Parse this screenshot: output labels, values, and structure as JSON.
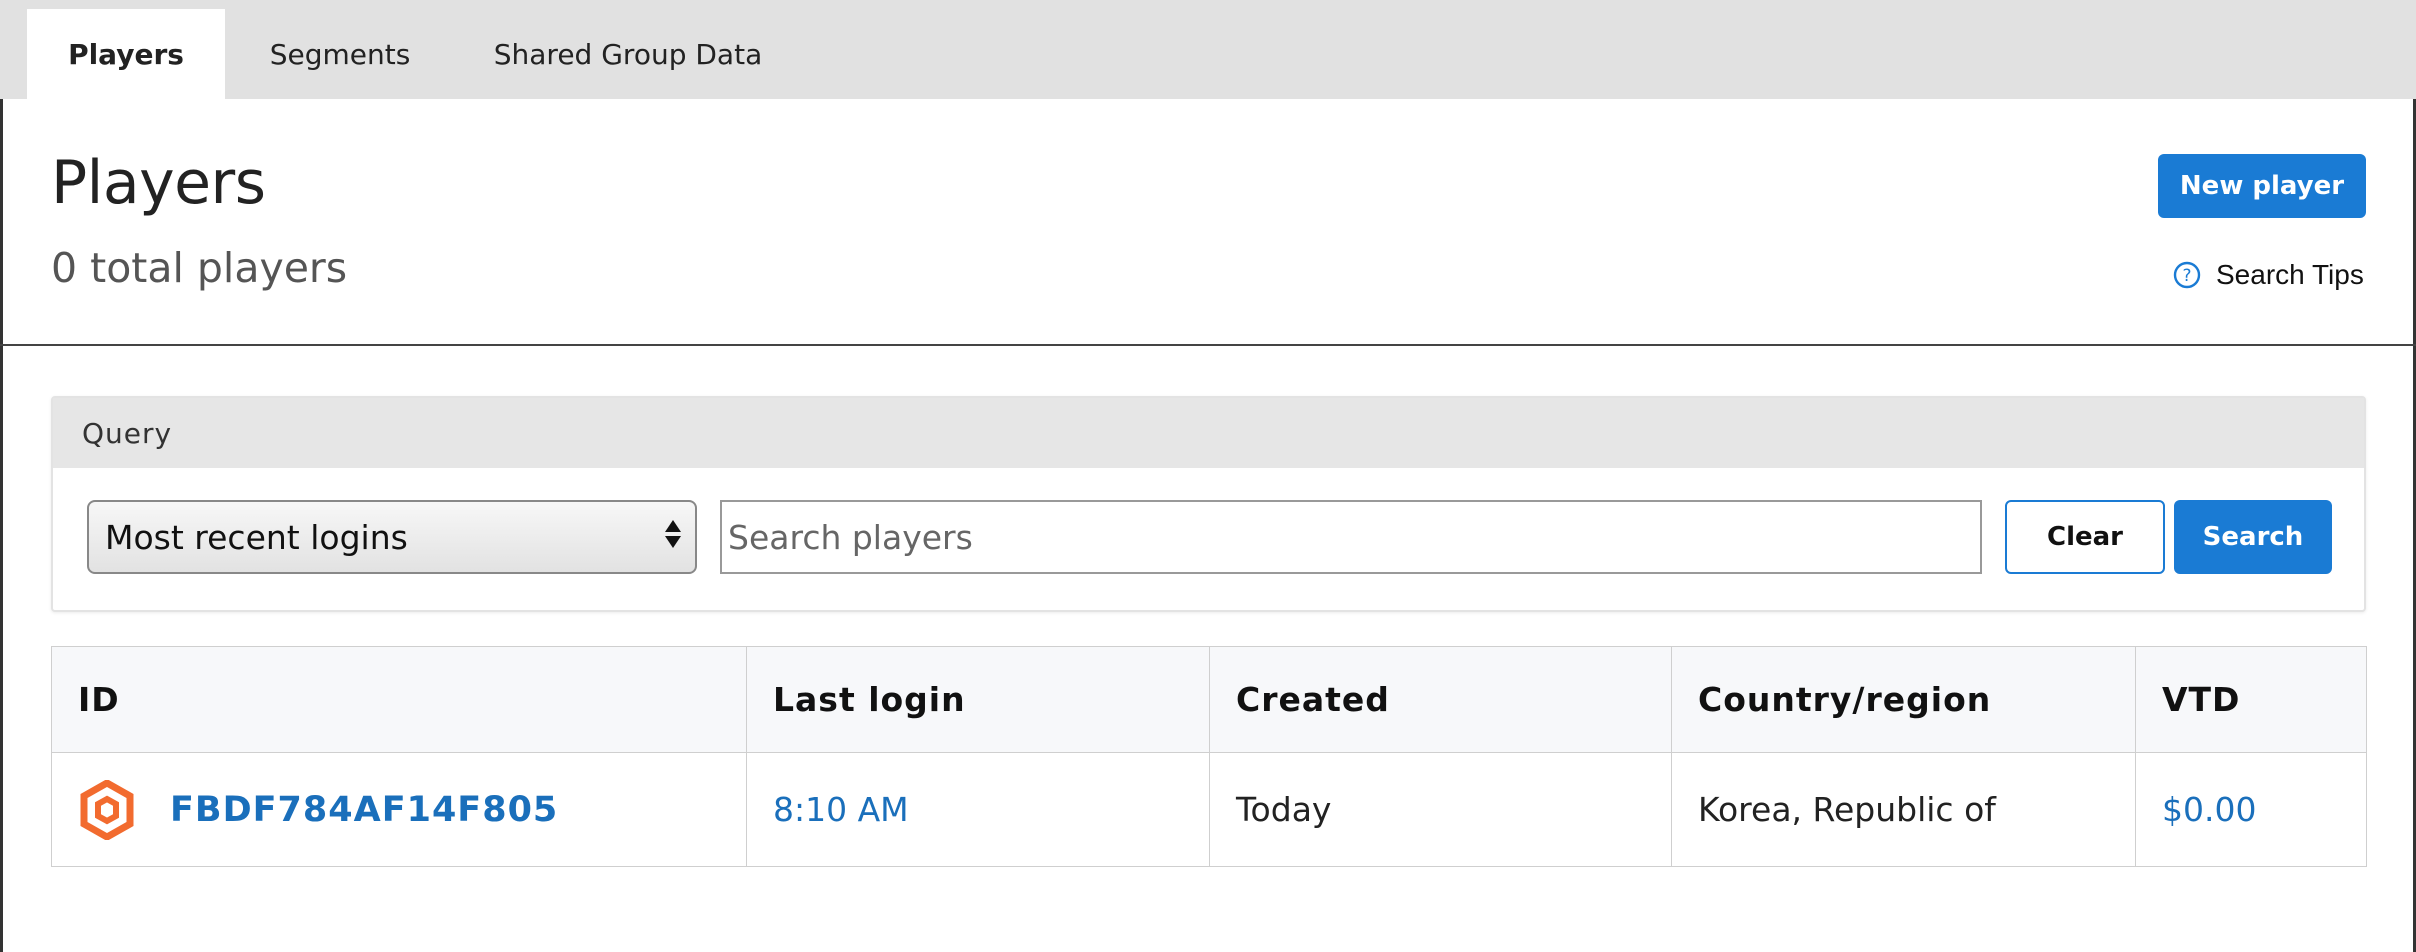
{
  "tabs": [
    {
      "label": "Players",
      "active": true
    },
    {
      "label": "Segments",
      "active": false
    },
    {
      "label": "Shared Group Data",
      "active": false
    }
  ],
  "header": {
    "title": "Players",
    "subtitle": "0 total players",
    "new_player_label": "New player",
    "search_tips_label": "Search Tips"
  },
  "query": {
    "title": "Query",
    "select_value": "Most recent logins",
    "search_placeholder": "Search players",
    "clear_label": "Clear",
    "search_label": "Search"
  },
  "table": {
    "columns": [
      "ID",
      "Last login",
      "Created",
      "Country/region",
      "VTD"
    ],
    "rows": [
      {
        "id": "FBDF784AF14F805",
        "last_login": "8:10 AM",
        "created": "Today",
        "country": "Korea, Republic of",
        "vtd": "$0.00",
        "icon": "player-hexagon-icon"
      }
    ]
  },
  "colors": {
    "accent": "#1a7bd4",
    "link": "#1a6fbb",
    "icon_orange": "#f26b2f",
    "tab_bar": "#e1e1e1"
  }
}
